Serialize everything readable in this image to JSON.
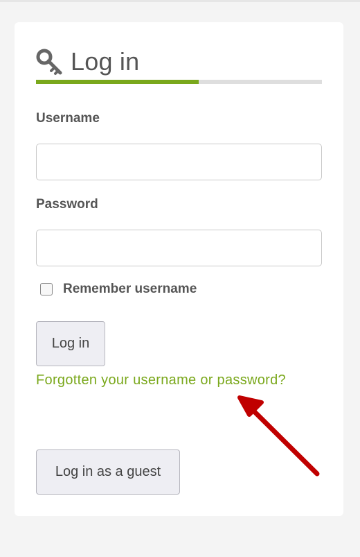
{
  "login": {
    "title": "Log in",
    "title_icon": "key-icon",
    "progress_fraction": 0.57,
    "username_label": "Username",
    "username_value": "",
    "password_label": "Password",
    "password_value": "",
    "remember_label": "Remember username",
    "remember_checked": false,
    "login_button": "Log in",
    "forgot_link": "Forgotten your username or password?",
    "guest_button": "Log in as a guest"
  },
  "colors": {
    "accent": "#7aa81c",
    "arrow": "#c00000",
    "background": "#f4f4f4"
  },
  "annotation": {
    "icon": "red-arrow-icon"
  }
}
